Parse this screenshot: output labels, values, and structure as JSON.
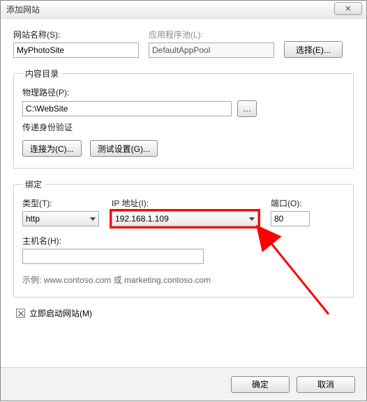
{
  "title": "添加网站",
  "close_glyph": "✕",
  "site_name_label": "网站名称(S):",
  "site_name_value": "MyPhotoSite",
  "app_pool_label": "应用程序池(L):",
  "app_pool_value": "DefaultAppPool",
  "select_button": "选择(E)...",
  "content_dir_legend": "内容目录",
  "phys_path_label": "物理路径(P):",
  "phys_path_value": "C:\\WebSite",
  "browse_glyph": "…",
  "passthrough_label": "传递身份验证",
  "connect_as_button": "连接为(C)...",
  "test_settings_button": "测试设置(G)...",
  "binding_legend": "绑定",
  "type_label": "类型(T):",
  "type_value": "http",
  "ip_label": "IP 地址(I):",
  "ip_value": "192.168.1.109",
  "port_label": "端口(O):",
  "port_value": "80",
  "hostname_label": "主机名(H):",
  "hostname_value": "",
  "example_text": "示例: www.contoso.com 或 marketing.contoso.com",
  "start_now_label": "立即启动网站(M)",
  "start_now_checked": true,
  "ok_button": "确定",
  "cancel_button": "取消"
}
